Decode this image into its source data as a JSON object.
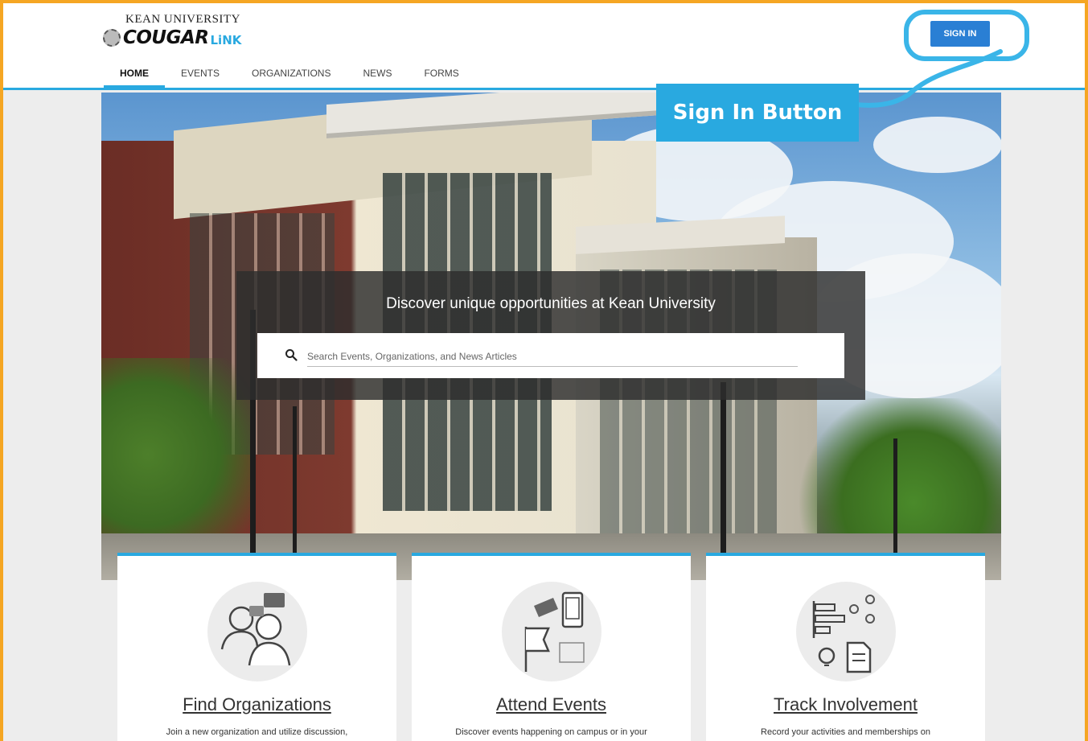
{
  "header": {
    "logo_top": "KEAN UNIVERSITY",
    "logo_main": "COUGAR",
    "logo_sub": "LiNK",
    "signin_label": "SIGN IN"
  },
  "nav": {
    "items": [
      "HOME",
      "EVENTS",
      "ORGANIZATIONS",
      "NEWS",
      "FORMS"
    ],
    "active": "HOME"
  },
  "annotation": {
    "label": "Sign In Button",
    "color": "#29a9e0"
  },
  "hero": {
    "title": "Discover unique opportunities at Kean University",
    "search_placeholder": "Search Events, Organizations, and News Articles"
  },
  "cards": [
    {
      "title": "Find Organizations",
      "desc": "Join a new organization and utilize discussion,",
      "icon": "people-chat-icon"
    },
    {
      "title": "Attend Events",
      "desc": "Discover events happening on campus or in your",
      "icon": "ticket-phone-icon"
    },
    {
      "title": "Track Involvement",
      "desc": "Record your activities and memberships on",
      "icon": "chart-document-icon"
    }
  ],
  "colors": {
    "accent": "#29a9e0",
    "button": "#2a7fd4",
    "frame": "#f5a623"
  }
}
